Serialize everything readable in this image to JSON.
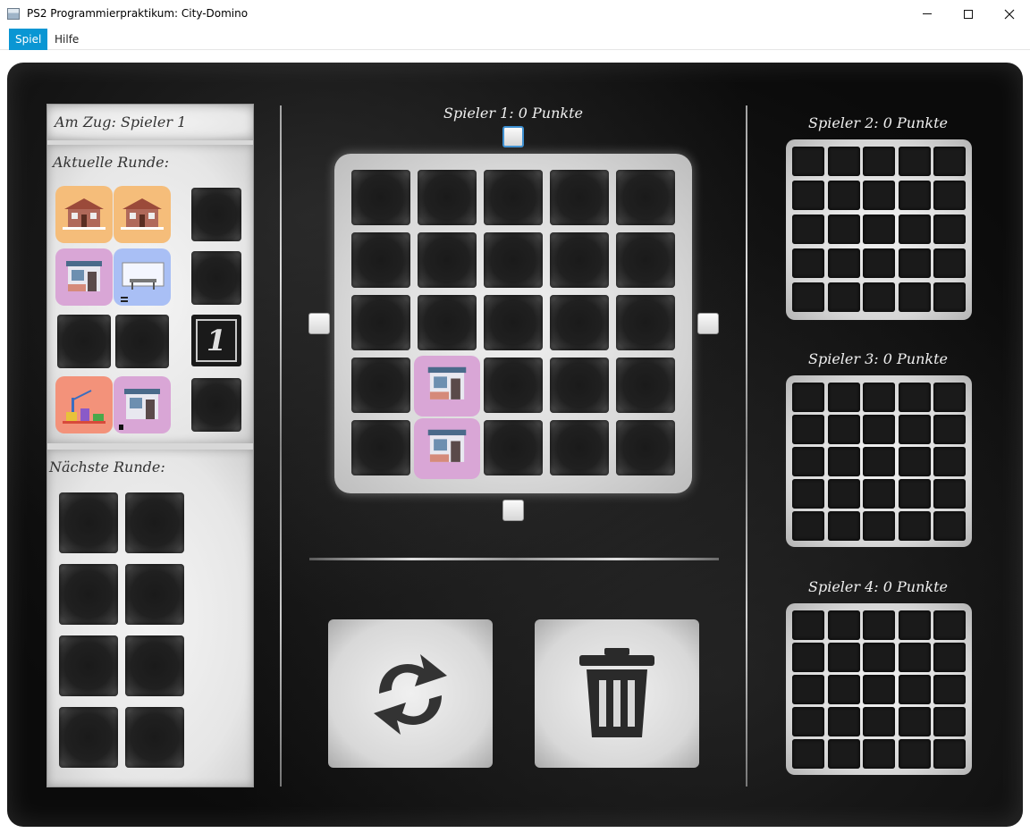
{
  "window": {
    "title": "PS2 Programmierpraktikum: City-Domino"
  },
  "menu": {
    "spiel": "Spiel",
    "hilfe": "Hilfe"
  },
  "left_panel": {
    "am_zug": "Am Zug: Spieler 1",
    "aktuelle_runde": "Aktuelle Runde:",
    "naechste_runde": "Nächste Runde:",
    "round_number": "1"
  },
  "players": {
    "p1": "Spieler 1: 0 Punkte",
    "p2": "Spieler 2: 0 Punkte",
    "p3": "Spieler 3: 0 Punkte",
    "p4": "Spieler 4: 0 Punkte"
  },
  "colors": {
    "accent": "#0a96d3",
    "tile_orange": "#f5bd7a",
    "tile_pink": "#d9a6d6",
    "tile_blue": "#a9bff5",
    "tile_red": "#f3927a"
  },
  "icons": {
    "rotate": "rotate-arrows-icon",
    "trash": "trash-can-icon"
  }
}
